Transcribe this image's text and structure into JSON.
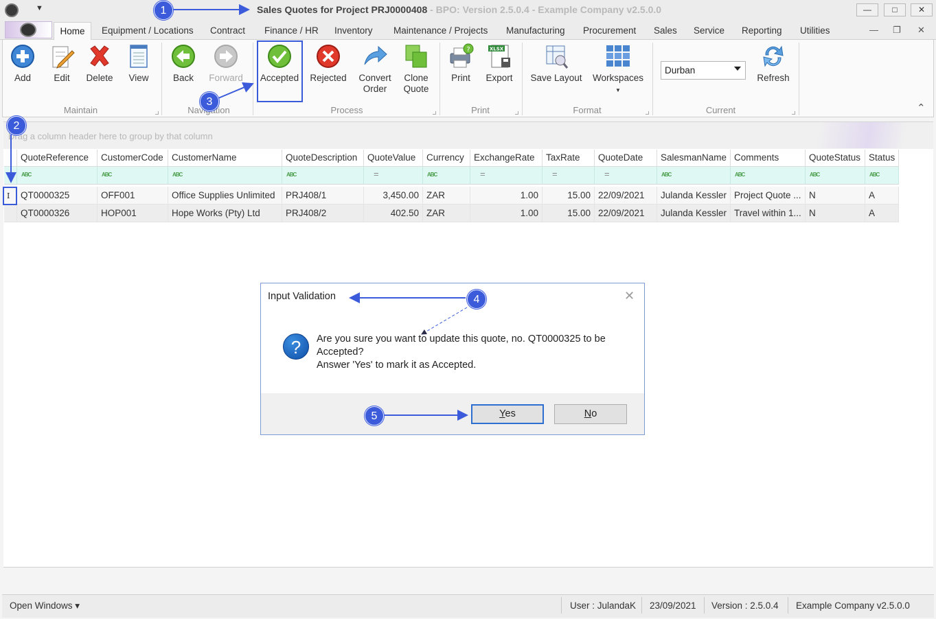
{
  "window": {
    "title": "Sales Quotes for Project PRJ0000408",
    "subtitle": " - BPO: Version 2.5.0.4 - Example Company v2.5.0.0",
    "controls": {
      "minimize": "—",
      "restore": "□",
      "close": "✕"
    }
  },
  "menu": {
    "tabs": [
      "Home",
      "Equipment / Locations",
      "Contract",
      "Finance / HR",
      "Inventory",
      "Maintenance / Projects",
      "Manufacturing",
      "Procurement",
      "Sales",
      "Service",
      "Reporting",
      "Utilities"
    ],
    "mdi_controls": {
      "minimize": "—",
      "restore": "❐",
      "close": "✕"
    }
  },
  "ribbon": {
    "groups": {
      "maintain": "Maintain",
      "navigation": "Navigation",
      "process": "Process",
      "print": "Print",
      "format": "Format",
      "current": "Current"
    },
    "buttons": {
      "add": "Add",
      "edit": "Edit",
      "delete": "Delete",
      "view": "View",
      "back": "Back",
      "forward": "Forward",
      "accepted": "Accepted",
      "rejected": "Rejected",
      "convert_order": "Convert\nOrder",
      "clone_quote": "Clone\nQuote",
      "print": "Print",
      "export": "Export",
      "save_layout": "Save Layout",
      "workspaces": "Workspaces",
      "refresh": "Refresh"
    },
    "export_badge": "XLSX",
    "site_combo": {
      "value": "Durban"
    },
    "collapse_glyph": "⌃"
  },
  "grid": {
    "group_hint": "Drag a column header here to group by that column",
    "columns": [
      "QuoteReference",
      "CustomerCode",
      "CustomerName",
      "QuoteDescription",
      "QuoteValue",
      "Currency",
      "ExchangeRate",
      "TaxRate",
      "QuoteDate",
      "SalesmanName",
      "Comments",
      "QuoteStatus",
      "Status"
    ],
    "filter_icons": {
      "text": "ABC",
      "numeric": "="
    },
    "rows": [
      [
        "QT0000325",
        "OFF001",
        "Office Supplies Unlimited",
        "PRJ408/1",
        "3,450.00",
        "ZAR",
        "1.00",
        "15.00",
        "22/09/2021",
        "Julanda Kessler",
        "Project Quote ...",
        "N",
        "A"
      ],
      [
        "QT0000326",
        "HOP001",
        "Hope Works (Pty) Ltd",
        "PRJ408/2",
        "402.50",
        "ZAR",
        "1.00",
        "15.00",
        "22/09/2021",
        "Julanda Kessler",
        "Travel within 1...",
        "N",
        "A"
      ]
    ],
    "edit_cursor": "I"
  },
  "dialog": {
    "title": "Input Validation",
    "close": "✕",
    "icon": "?",
    "message_line1": "Are you sure you want to update this quote, no. QT0000325 to be",
    "message_line2": "Accepted?",
    "message_line3": "Answer 'Yes' to mark it as Accepted.",
    "yes_mnemonic": "Y",
    "yes_rest": "es",
    "no_mnemonic": "N",
    "no_rest": "o"
  },
  "statusbar": {
    "open_windows": "Open Windows ▾",
    "user": "User : JulandaK",
    "date": "23/09/2021",
    "version": "Version : 2.5.0.4",
    "company": "Example Company v2.5.0.0"
  },
  "annotations": [
    "1",
    "2",
    "3",
    "4",
    "5"
  ],
  "colors": {
    "annotation": "#3b5bdb",
    "filter_row": "#dff8f4",
    "accent": "#2c6fd1"
  }
}
